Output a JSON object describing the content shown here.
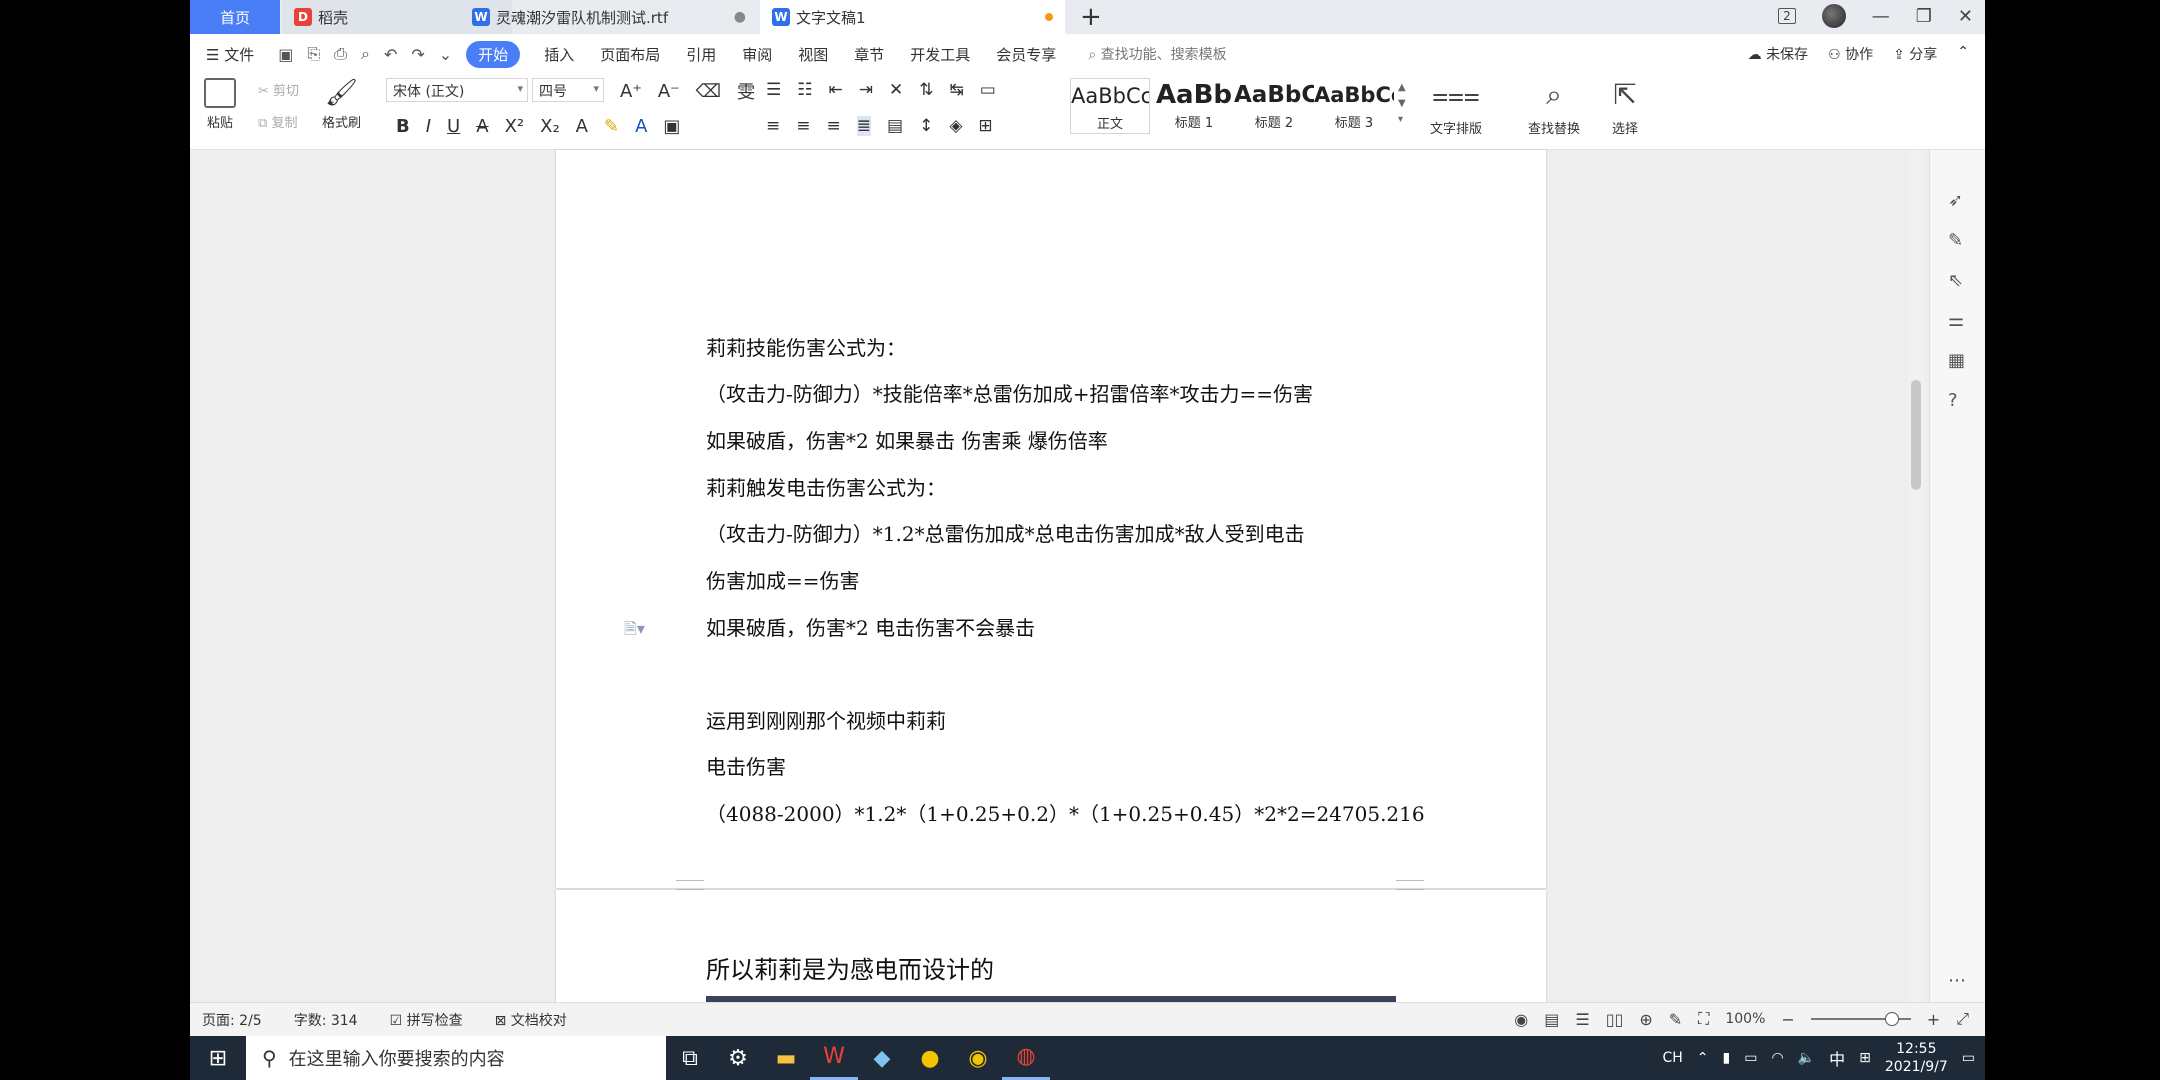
{
  "tabs": {
    "home": "首页",
    "daoke": "稻壳",
    "rtf": "灵魂潮汐雷队机制测试.rtf",
    "doc": "文字文稿1",
    "add": "+"
  },
  "window": {
    "badge": "2"
  },
  "menu": {
    "file": "文件",
    "items": [
      "开始",
      "插入",
      "页面布局",
      "引用",
      "审阅",
      "视图",
      "章节",
      "开发工具",
      "会员专享"
    ],
    "search_placeholder": "查找功能、搜索模板",
    "unsaved": "未保存",
    "collab": "协作",
    "share": "分享"
  },
  "ribbon": {
    "paste": "粘贴",
    "cut": "剪切",
    "copy": "复制",
    "format_painter": "格式刷",
    "font_name": "宋体 (正文)",
    "font_size": "四号",
    "styles": [
      {
        "sample": "AaBbCcDd",
        "name": "正文"
      },
      {
        "sample": "AaBb",
        "name": "标题 1"
      },
      {
        "sample": "AaBbC",
        "name": "标题 2"
      },
      {
        "sample": "AaBbCc",
        "name": "标题 3"
      }
    ],
    "text_layout": "文字排版",
    "find_replace": "查找替换",
    "select": "选择"
  },
  "document": {
    "lines": [
      "莉莉技能伤害公式为：",
      "（攻击力-防御力）*技能倍率*总雷伤加成+招雷倍率*攻击力==伤害",
      "如果破盾，伤害*2      如果暴击  伤害乘  爆伤倍率",
      "莉莉触发电击伤害公式为：",
      "（攻击力-防御力）*1.2*总雷伤加成*总电击伤害加成*敌人受到电击",
      "伤害加成==伤害",
      "如果破盾，伤害*2         电击伤害不会暴击",
      "运用到刚刚那个视频中莉莉",
      "电击伤害",
      "（4088-2000）*1.2*（1+0.25+0.2）*（1+0.25+0.45）*2*2=24705.216"
    ],
    "page2_heading": "所以莉莉是为感电而设计的"
  },
  "status": {
    "page": "页面: 2/5",
    "words": "字数: 314",
    "spell": "拼写检查",
    "proof": "文档校对",
    "zoom": "100%",
    "zoom_level": 0.5
  },
  "taskbar": {
    "search_placeholder": "在这里输入你要搜索的内容",
    "ime": "中",
    "lang": "CH",
    "time": "12:55",
    "date": "2021/9/7"
  }
}
